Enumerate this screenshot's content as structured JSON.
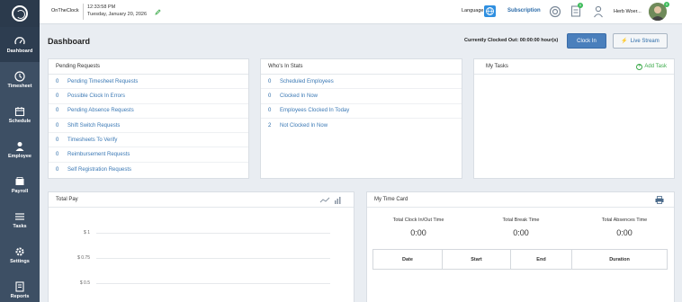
{
  "sidebar": {
    "items": [
      {
        "label": "Dashboard",
        "icon": "dashboard-gauge-icon"
      },
      {
        "label": "Timesheet",
        "icon": "clock-icon"
      },
      {
        "label": "Schedule",
        "icon": "calendar-icon"
      },
      {
        "label": "Employee",
        "icon": "person-icon"
      },
      {
        "label": "Payroll",
        "icon": "wallet-icon"
      },
      {
        "label": "Tasks",
        "icon": "list-icon"
      },
      {
        "label": "Settings",
        "icon": "gear-icon"
      },
      {
        "label": "Reports",
        "icon": "report-icon"
      }
    ]
  },
  "topbar": {
    "brand": "OnTheClock",
    "time": "12:33:58 PM",
    "date": "Tuesday, January 20, 2026",
    "language_label": "Language",
    "subscription": "Subscription",
    "notif_count": "0",
    "user_name": "Herb Woer...",
    "avatar_badge": "0"
  },
  "header": {
    "title": "Dashboard",
    "clocked_out": "Currently Clocked Out: 00:00:00 hour(s)",
    "clock_in": "Clock In",
    "live_stream": "Live Stream"
  },
  "pending": {
    "title": "Pending Requests",
    "rows": [
      {
        "count": "0",
        "label": "Pending Timesheet Requests"
      },
      {
        "count": "0",
        "label": "Possible Clock In Errors"
      },
      {
        "count": "0",
        "label": "Pending Absence Requests"
      },
      {
        "count": "0",
        "label": "Shift Switch Requests"
      },
      {
        "count": "0",
        "label": "Timesheets To Verify"
      },
      {
        "count": "0",
        "label": "Reimbursement Requests"
      },
      {
        "count": "0",
        "label": "Self Registration Requests"
      }
    ]
  },
  "whos_in": {
    "title": "Who's In Stats",
    "rows": [
      {
        "count": "0",
        "label": "Scheduled Employees"
      },
      {
        "count": "0",
        "label": "Clocked In Now"
      },
      {
        "count": "0",
        "label": "Employees Clocked In Today"
      },
      {
        "count": "2",
        "label": "Not Clocked In Now"
      }
    ]
  },
  "tasks": {
    "title": "My Tasks",
    "add": "Add Task"
  },
  "total_pay": {
    "title": "Total Pay",
    "ticks": [
      "$ 1",
      "$ 0.75",
      "$ 0.5"
    ]
  },
  "time_card": {
    "title": "My Time Card",
    "stats": [
      {
        "label": "Total Clock In/Out Time",
        "value": "0:00"
      },
      {
        "label": "Total Break Time",
        "value": "0:00"
      },
      {
        "label": "Total Absences Time",
        "value": "0:00"
      }
    ],
    "columns": [
      "Date",
      "Start",
      "End",
      "Duration"
    ]
  },
  "colors": {
    "sidebar": "#3d4f64",
    "accent": "#4a7fbc",
    "link": "#3b79b5",
    "green": "#3caa4a"
  }
}
